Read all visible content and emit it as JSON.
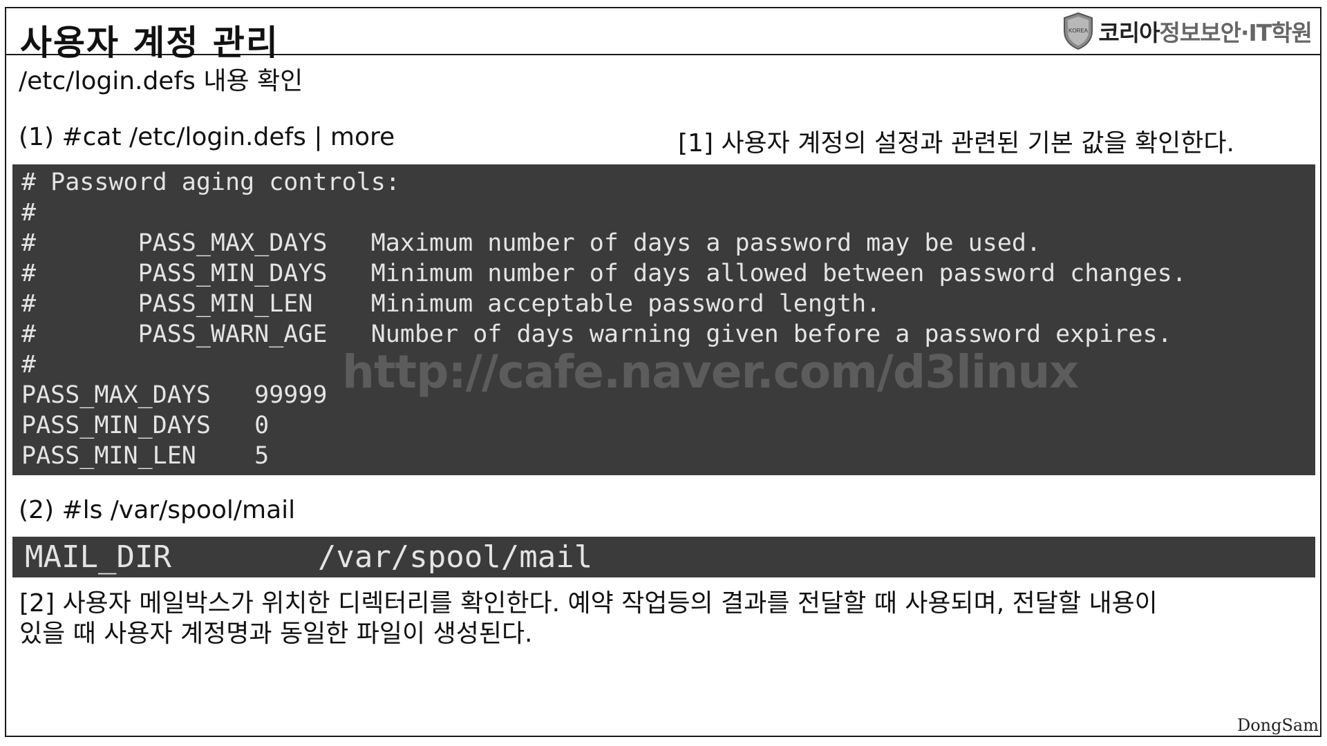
{
  "header": {
    "title": "사용자 계정 관리",
    "logo": {
      "icon": "korea-shield-icon",
      "badge_text": "KOREA",
      "name_bold": "코리아",
      "name_light": "정보보안·IT학원"
    }
  },
  "subtitle": "/etc/login.defs 내용 확인",
  "step1": {
    "command": "(1)   #cat /etc/login.defs | more",
    "note": "[1] 사용자 계정의 설정과 관련된 기본 값을 확인한다."
  },
  "terminal1": {
    "lines": [
      "# Password aging controls:",
      "#",
      "#       PASS_MAX_DAYS   Maximum number of days a password may be used.",
      "#       PASS_MIN_DAYS   Minimum number of days allowed between password changes.",
      "#       PASS_MIN_LEN    Minimum acceptable password length.",
      "#       PASS_WARN_AGE   Number of days warning given before a password expires.",
      "#",
      "PASS_MAX_DAYS   99999",
      "PASS_MIN_DAYS   0",
      "PASS_MIN_LEN    5"
    ]
  },
  "watermark": "http://cafe.naver.com/d3linux",
  "step2": {
    "command": "(2)  #ls /var/spool/mail"
  },
  "terminal2": {
    "line": "MAIL_DIR        /var/spool/mail"
  },
  "note2": {
    "line1": "[2] 사용자 메일박스가 위치한 디렉터리를 확인한다. 예약 작업등의 결과를 전달할 때 사용되며, 전달할 내용이",
    "line2": "있을 때 사용자 계정명과 동일한 파일이 생성된다."
  },
  "signature": "DongSam",
  "colors": {
    "terminal_bg": "#3b3b3b",
    "terminal_fg": "#e4e4e4",
    "border": "#1a1a1a"
  }
}
